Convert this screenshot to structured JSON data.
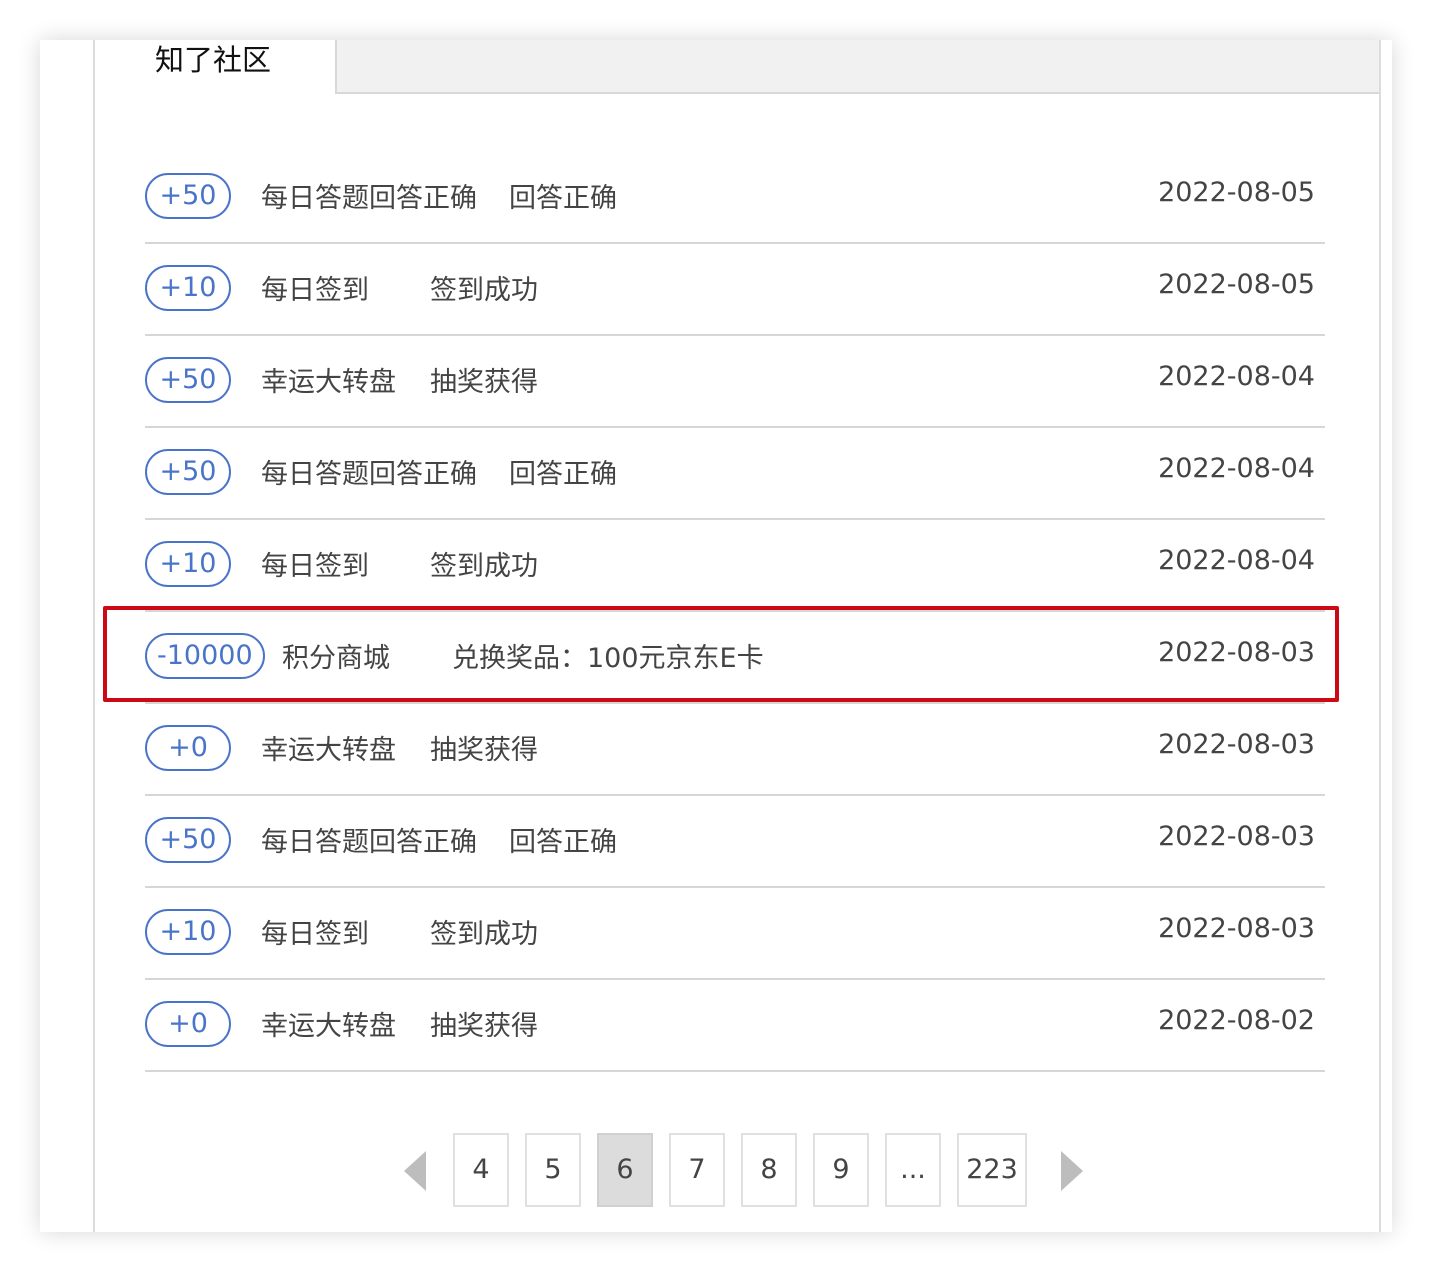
{
  "tabs": {
    "active_label": "知了社区"
  },
  "records": [
    {
      "points": "+50",
      "source": "每日答题回答正确",
      "desc": "回答正确",
      "date": "2022-08-05"
    },
    {
      "points": "+10",
      "source": "每日签到",
      "desc": "签到成功",
      "date": "2022-08-05"
    },
    {
      "points": "+50",
      "source": "幸运大转盘",
      "desc": "抽奖获得",
      "date": "2022-08-04"
    },
    {
      "points": "+50",
      "source": "每日答题回答正确",
      "desc": "回答正确",
      "date": "2022-08-04"
    },
    {
      "points": "+10",
      "source": "每日签到",
      "desc": "签到成功",
      "date": "2022-08-04"
    },
    {
      "points": "-10000",
      "source": "积分商城",
      "desc": "兑换奖品：100元京东E卡",
      "date": "2022-08-03"
    },
    {
      "points": "+0",
      "source": "幸运大转盘",
      "desc": "抽奖获得",
      "date": "2022-08-03"
    },
    {
      "points": "+50",
      "source": "每日答题回答正确",
      "desc": "回答正确",
      "date": "2022-08-03"
    },
    {
      "points": "+10",
      "source": "每日签到",
      "desc": "签到成功",
      "date": "2022-08-03"
    },
    {
      "points": "+0",
      "source": "幸运大转盘",
      "desc": "抽奖获得",
      "date": "2022-08-02"
    }
  ],
  "pagination": {
    "pages": [
      "4",
      "5",
      "6",
      "7",
      "8",
      "9",
      "...",
      "223"
    ],
    "current": "6",
    "prev_icon": "triangle-left-icon",
    "next_icon": "triangle-right-icon"
  },
  "colors": {
    "accent": "#4a74c9",
    "highlight_border": "#cc0a16"
  }
}
